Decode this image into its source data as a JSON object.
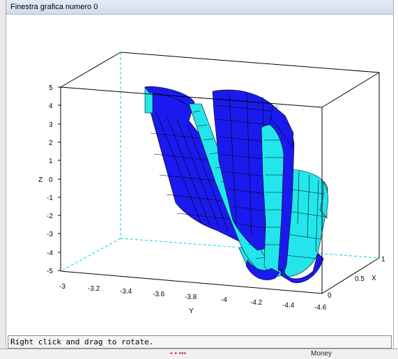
{
  "window": {
    "title": "Finestra grafica numero 0"
  },
  "status": {
    "message": "Right click and drag to rotate."
  },
  "background": {
    "taskbar_label": "Money",
    "taskbar_misc": "▪ • •••"
  },
  "axes": {
    "z_label": "Z",
    "y_label": "Y",
    "x_label": "X",
    "z_ticks": [
      "5",
      "4",
      "3",
      "2",
      "1",
      "0",
      "-1",
      "-2",
      "-3",
      "-4",
      "-5"
    ],
    "y_ticks": [
      "-3",
      "-3.2",
      "-3.4",
      "-3.6",
      "-3.8",
      "-4",
      "-4.2",
      "-4.4",
      "-4.6"
    ],
    "x_ticks": [
      "0",
      "0.5",
      "1"
    ]
  },
  "colors": {
    "surface_front": "#1a1aef",
    "surface_back": "#23e6ec",
    "box": "#000000",
    "hidden_box": "#00d4ee"
  }
}
